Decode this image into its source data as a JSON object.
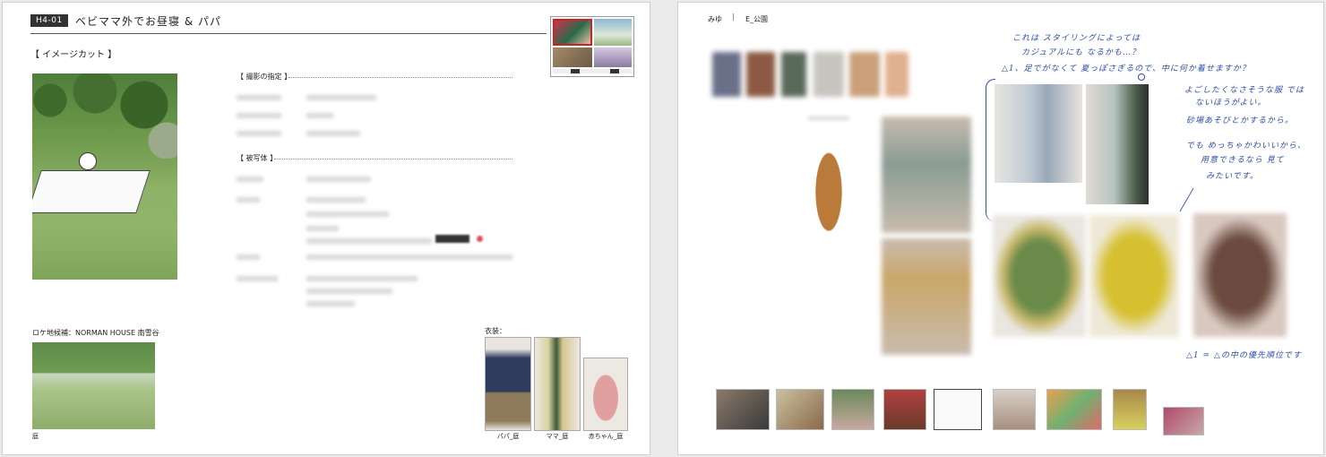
{
  "left_page": {
    "code": "H4-01",
    "title": "ベビママ外でお昼寝 & パパ",
    "image_cut_label": "【 イメージカット 】",
    "shooting_spec_label": "【 撮影の指定 】",
    "subject_label": "【 被写体 】",
    "location_label": "ロケ地候補：NORMAN HOUSE 南雪谷",
    "location_caption": "庭",
    "costume_label": "衣装：",
    "costumes": [
      {
        "caption": "パパ_庭"
      },
      {
        "caption": "ママ_庭"
      },
      {
        "caption": "赤ちゃん_庭"
      }
    ]
  },
  "right_page": {
    "person": "みゆ",
    "separator": "|",
    "scene": "E_公園",
    "notes": {
      "top_line1": "これは スタイリングによっては",
      "top_line2": "カジュアルにも なるかも…？",
      "top_line3": "△1、足でがなくて 夏っぽさぎるので、中に何か着せますか？",
      "side_line1": "よごしたくなさそうな服 では",
      "side_line2": "ないほうがよい。",
      "side_line3": "砂場あそびとかするから。",
      "side_line4": "でも めっちゃかわいいから、",
      "side_line5": "用意できるなら 見て",
      "side_line6": "みたいです。",
      "bottom_line": "△1 = △の中の優先順位です",
      "triangle_mark": "△1",
      "circle_mark": "○"
    }
  }
}
